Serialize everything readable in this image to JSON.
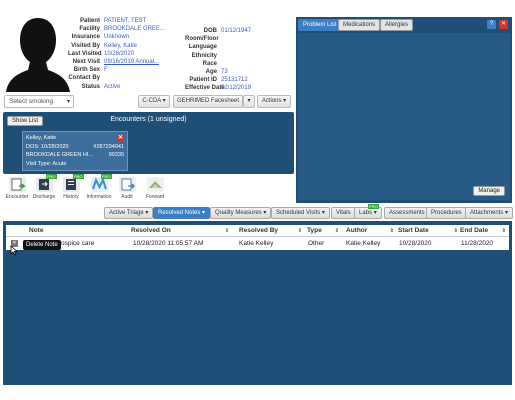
{
  "patient": {
    "left": [
      {
        "label": "Patient",
        "value": "PATIENT, TEST"
      },
      {
        "label": "Facility",
        "value": "BROOKDALE GREE..."
      },
      {
        "label": "Insurance",
        "value": "Unknown"
      },
      {
        "label": "Visited By",
        "value": "Kelley, Katie"
      },
      {
        "label": "Last Visited",
        "value": "10/28/2020"
      },
      {
        "label": "Next Visit",
        "value": "09/16/2019 Annual..."
      },
      {
        "label": "Birth Sex",
        "value": "F"
      },
      {
        "label": "Contact By",
        "value": ""
      },
      {
        "label": "Status",
        "value": "Active"
      }
    ],
    "right": [
      {
        "label": "DOB",
        "value": "01/12/1947"
      },
      {
        "label": "Room/Floor",
        "value": ""
      },
      {
        "label": "Language",
        "value": ""
      },
      {
        "label": "Ethnicity",
        "value": ""
      },
      {
        "label": "Race",
        "value": ""
      },
      {
        "label": "Age",
        "value": "73"
      },
      {
        "label": "Patient ID",
        "value": "25131712"
      },
      {
        "label": "Effective Date",
        "value": "02/12/2019"
      }
    ]
  },
  "smoking": {
    "placeholder": "Select smoking"
  },
  "actions": {
    "ccda": "C-CDA",
    "facesheet": "GEHRIMED Facesheet",
    "actions": "Actions"
  },
  "encounters": {
    "show_list": "Show List",
    "title": "Encounters (1 unsigned)",
    "card": {
      "provider": "Kelley, Katie",
      "dos": "DOS: 10/28/2020",
      "id": "#287294041",
      "facility": "BROOKDALE GREEN HI...",
      "zip": "99335",
      "visit_type": "Visit Type: Acute"
    }
  },
  "toolbar": [
    {
      "label": "Encounter",
      "icon": "encounter-icon",
      "color": "#4a9a3a",
      "badge": ""
    },
    {
      "label": "Discharge",
      "icon": "discharge-icon",
      "color": "#2e3e4e",
      "badge": "PRO"
    },
    {
      "label": "History",
      "icon": "history-icon",
      "color": "#2e3e4e",
      "badge": "PRO"
    },
    {
      "label": "Information",
      "icon": "information-icon",
      "color": "#3a8fd0",
      "badge": "PRO"
    },
    {
      "label": "Audit",
      "icon": "audit-icon",
      "color": "#5a7a9a",
      "badge": ""
    },
    {
      "label": "Forward",
      "icon": "forward-icon",
      "color": "#7a9a5a",
      "badge": ""
    }
  ],
  "problem_panel": {
    "tabs": [
      "Problem List",
      "Medications",
      "Allergies"
    ],
    "help": "?",
    "manage": "Manage"
  },
  "note_tabs": [
    {
      "label": "Active Triage",
      "caret": true,
      "active": false,
      "badge": ""
    },
    {
      "label": "Resolved Notes",
      "caret": true,
      "active": true,
      "badge": ""
    },
    {
      "label": "Quality Measures",
      "caret": true,
      "active": false,
      "badge": ""
    },
    {
      "label": "Scheduled Visits",
      "caret": true,
      "active": false,
      "badge": ""
    },
    {
      "label": "Vitals",
      "caret": false,
      "active": false,
      "badge": ""
    },
    {
      "label": "Labs",
      "caret": true,
      "active": false,
      "badge": "PRO"
    },
    {
      "label": "Assessments",
      "caret": false,
      "active": false,
      "badge": ""
    },
    {
      "label": "Procedures",
      "caret": false,
      "active": false,
      "badge": ""
    },
    {
      "label": "Attachments",
      "caret": true,
      "active": false,
      "badge": ""
    }
  ],
  "grid": {
    "columns": [
      "Note",
      "Resolved On",
      "Resolved By",
      "Type",
      "Author",
      "Start Date",
      "End Date"
    ],
    "rows": [
      [
        "ospice care",
        "10/28/2020 11:05:57 AM",
        "Katie Kelley",
        "Other",
        "Katie Kelley",
        "10/28/2020",
        "11/28/2020"
      ]
    ],
    "tooltip": "Delete Note"
  },
  "colors": {
    "panel": "#1f4e78",
    "accent": "#3b7ec4",
    "link": "#3a5cc9",
    "danger": "#d9322b"
  }
}
